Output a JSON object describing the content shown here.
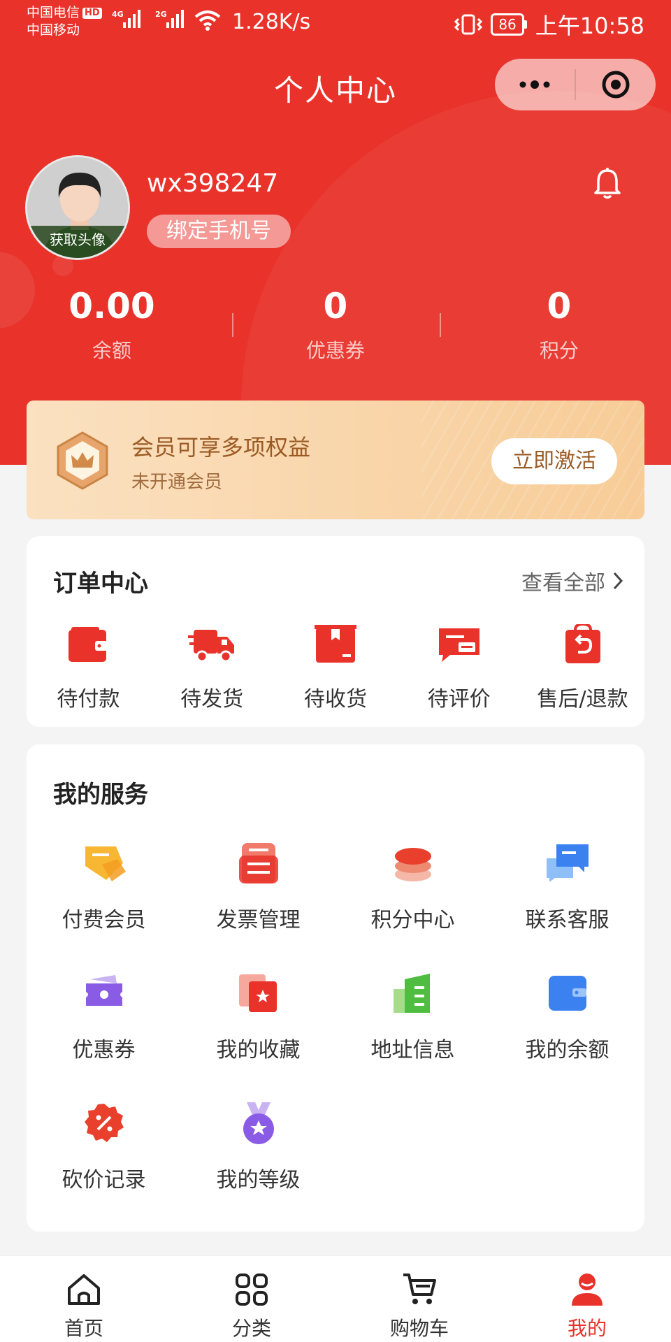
{
  "status_bar": {
    "carrier1": "中国电信",
    "hd": "HD",
    "carrier2": "中国移动",
    "sig1": "4G",
    "sig2": "2G",
    "net_speed": "1.28K/s",
    "battery": "86",
    "time": "上午10:58"
  },
  "navbar": {
    "title": "个人中心",
    "more_icon": "more-dots-icon",
    "close_icon": "target-close-icon"
  },
  "profile": {
    "username": "wx398247",
    "avatar_label": "获取头像",
    "bind_phone": "绑定手机号"
  },
  "stats": [
    {
      "value": "0.00",
      "label": "余额"
    },
    {
      "value": "0",
      "label": "优惠券"
    },
    {
      "value": "0",
      "label": "积分"
    }
  ],
  "vip": {
    "title": "会员可享多项权益",
    "subtitle": "未开通会员",
    "button": "立即激活"
  },
  "orders": {
    "title": "订单中心",
    "view_all": "查看全部",
    "items": [
      {
        "label": "待付款",
        "icon": "wallet-icon"
      },
      {
        "label": "待发货",
        "icon": "truck-icon"
      },
      {
        "label": "待收货",
        "icon": "box-icon"
      },
      {
        "label": "待评价",
        "icon": "comment-icon"
      },
      {
        "label": "售后/退款",
        "icon": "refund-bag-icon"
      }
    ]
  },
  "services": {
    "title": "我的服务",
    "items": [
      {
        "label": "付费会员",
        "icon": "vip-tag-icon"
      },
      {
        "label": "发票管理",
        "icon": "invoice-icon"
      },
      {
        "label": "积分中心",
        "icon": "coins-icon"
      },
      {
        "label": "联系客服",
        "icon": "chat-icon"
      },
      {
        "label": "优惠券",
        "icon": "ticket-icon"
      },
      {
        "label": "我的收藏",
        "icon": "favorite-icon"
      },
      {
        "label": "地址信息",
        "icon": "building-icon"
      },
      {
        "label": "我的余额",
        "icon": "balance-wallet-icon"
      },
      {
        "label": "砍价记录",
        "icon": "discount-icon"
      },
      {
        "label": "我的等级",
        "icon": "medal-icon"
      }
    ]
  },
  "tabbar": [
    {
      "label": "首页",
      "icon": "home-icon",
      "active": false
    },
    {
      "label": "分类",
      "icon": "category-icon",
      "active": false
    },
    {
      "label": "购物车",
      "icon": "cart-icon",
      "active": false
    },
    {
      "label": "我的",
      "icon": "user-icon",
      "active": true
    }
  ],
  "colors": {
    "primary": "#e8322a",
    "vip_text": "#9a5a24"
  }
}
